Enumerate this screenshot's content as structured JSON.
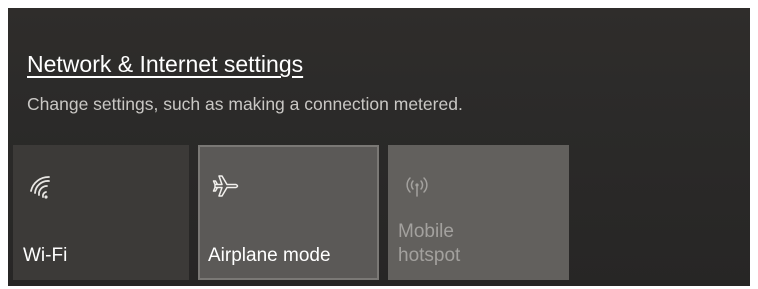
{
  "network_flyout": {
    "settings_link": "Network & Internet settings",
    "settings_description": "Change settings, such as making a connection metered."
  },
  "quick_actions": [
    {
      "label": "Wi-Fi",
      "icon": "wifi-icon",
      "state": "off"
    },
    {
      "label": "Airplane mode",
      "icon": "airplane-icon",
      "state": "on"
    },
    {
      "label_line1": "Mobile",
      "label_line2": "hotspot",
      "icon": "mobile-hotspot-icon",
      "state": "disabled"
    }
  ],
  "colors": {
    "background": "#2b2a29",
    "tile_off": "#3c3a38",
    "tile_on": "#5b5957",
    "tile_disabled": "#62605d",
    "disabled_text": "#a3a19e"
  }
}
